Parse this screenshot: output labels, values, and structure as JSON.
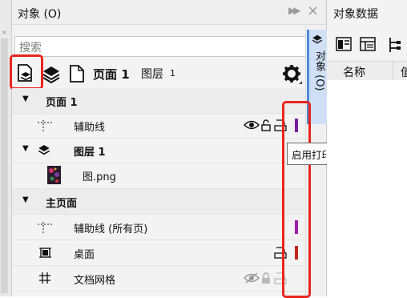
{
  "objects_panel": {
    "title": "对象 (O)",
    "search_placeholder": "搜索",
    "toolbar": {
      "current_page": "页面 1",
      "current_layer_label": "图层",
      "current_layer_number": "1"
    },
    "side_tab_label": "对象 (O)",
    "tree": [
      {
        "type": "section",
        "label": "页面 1"
      },
      {
        "type": "item",
        "label": "辅助线",
        "icon": "guides-icon",
        "color": "#7a1fa2"
      },
      {
        "type": "layer",
        "label": "图层 1",
        "icon": "layers-icon"
      },
      {
        "type": "item",
        "label": "图.png",
        "icon": "image-thumbnail"
      },
      {
        "type": "section",
        "label": "主页面"
      },
      {
        "type": "item",
        "label": "辅助线 (所有页)",
        "icon": "guides-icon",
        "color": "#9b1fa8"
      },
      {
        "type": "item",
        "label": "桌面",
        "icon": "desktop-icon",
        "color": "#c0281e"
      },
      {
        "type": "item",
        "label": "文档网格",
        "icon": "grid-icon"
      }
    ],
    "tooltip": "启用打印和导出(&E)"
  },
  "object_data_panel": {
    "title": "对象数据",
    "columns": [
      "名称",
      "值"
    ]
  },
  "colors": {
    "highlight": "#e8261e",
    "tab_selected": "#cfe0f5",
    "accent_blue": "#4f8ad8"
  }
}
